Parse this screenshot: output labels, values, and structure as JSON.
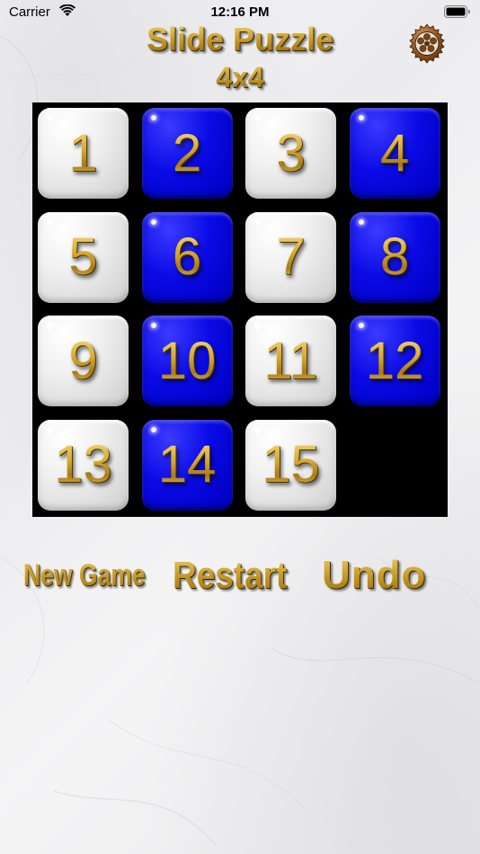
{
  "status_bar": {
    "carrier": "Carrier",
    "time": "12:16 PM",
    "wifi_icon": "wifi-icon",
    "battery_icon": "battery-icon"
  },
  "header": {
    "title": "Slide Puzzle",
    "subtitle": "4x4",
    "settings_icon": "gear-icon"
  },
  "board": {
    "rows": 4,
    "cols": 4,
    "tiles": [
      {
        "label": "1",
        "color": "white"
      },
      {
        "label": "2",
        "color": "blue"
      },
      {
        "label": "3",
        "color": "white"
      },
      {
        "label": "4",
        "color": "blue"
      },
      {
        "label": "5",
        "color": "white"
      },
      {
        "label": "6",
        "color": "blue"
      },
      {
        "label": "7",
        "color": "white"
      },
      {
        "label": "8",
        "color": "blue"
      },
      {
        "label": "9",
        "color": "white"
      },
      {
        "label": "10",
        "color": "blue"
      },
      {
        "label": "11",
        "color": "white"
      },
      {
        "label": "12",
        "color": "blue"
      },
      {
        "label": "13",
        "color": "white"
      },
      {
        "label": "14",
        "color": "blue"
      },
      {
        "label": "15",
        "color": "white"
      },
      null
    ]
  },
  "actions": {
    "new_game": "New Game",
    "restart": "Restart",
    "undo": "Undo"
  },
  "colors": {
    "gold": "#c9a22a",
    "tile_blue": "#0a0ae6",
    "tile_white": "#e8e8e8",
    "board_background": "#000000"
  }
}
